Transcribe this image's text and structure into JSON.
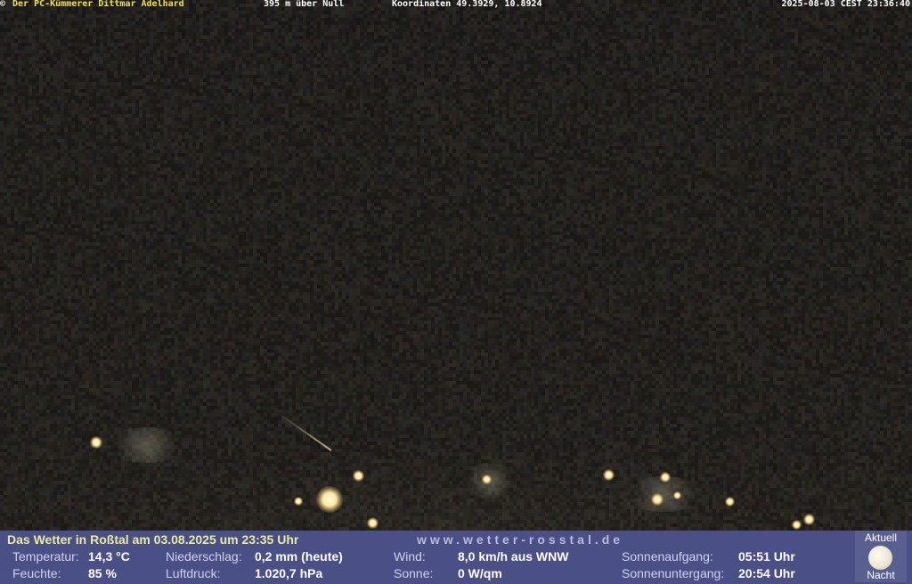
{
  "overlay": {
    "copyright": "©",
    "owner": "Der PC-Kümmerer Dittmar Adelhard",
    "altitude": "395 m über Null",
    "coordinates": "Koordinaten 49.3929, 10.8924",
    "timestamp": "2025-08-03 CEST 23:36:40"
  },
  "weather": {
    "title": "Das Wetter in Roßtal am 03.08.2025 um 23:35 Uhr",
    "website": "www.wetter-rosstal.de",
    "temperature": {
      "label": "Temperatur:",
      "value": "14,3 °C"
    },
    "humidity": {
      "label": "Feuchte:",
      "value": "85 %"
    },
    "precipitation": {
      "label": "Niederschlag:",
      "value": "0,2 mm (heute)"
    },
    "pressure": {
      "label": "Luftdruck:",
      "value": "1.020,7 hPa"
    },
    "wind": {
      "label": "Wind:",
      "value": "8,0 km/h aus WNW"
    },
    "sun": {
      "label": "Sonne:",
      "value": "0 W/qm"
    },
    "sunrise": {
      "label": "Sonnenaufgang:",
      "value": "05:51 Uhr"
    },
    "sunset": {
      "label": "Sonnenuntergang:",
      "value": "20:54 Uhr"
    },
    "moon": {
      "top_label": "Aktuell",
      "bottom_label": "Nacht",
      "icon": "moon-icon"
    }
  },
  "colors": {
    "panel": "#4a4f86",
    "owner_text": "#f2e24a",
    "title_text": "#e8ec9a"
  }
}
